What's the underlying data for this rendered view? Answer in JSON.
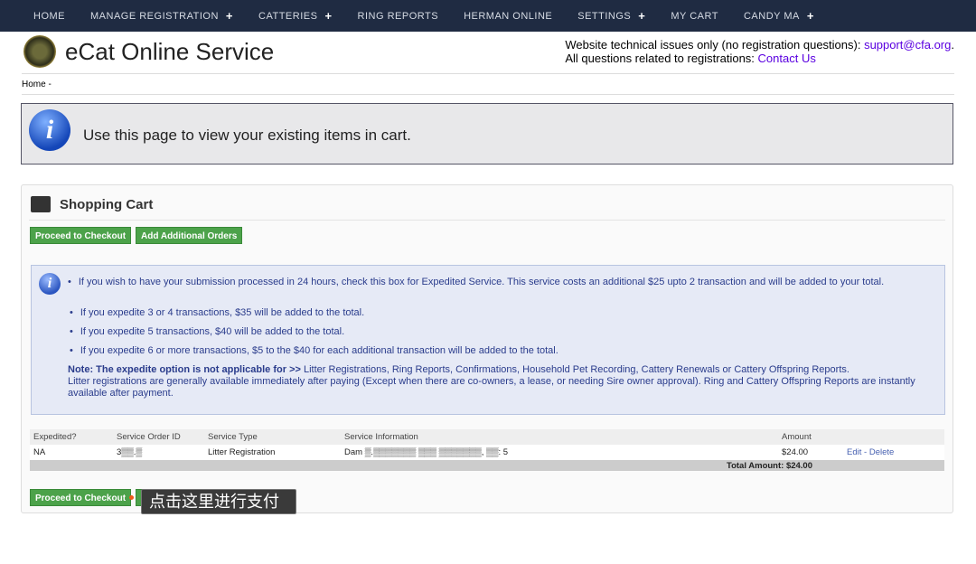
{
  "nav": {
    "items": [
      {
        "label": "HOME",
        "plus": false
      },
      {
        "label": "MANAGE REGISTRATION",
        "plus": true
      },
      {
        "label": "CATTERIES",
        "plus": true
      },
      {
        "label": "RING REPORTS",
        "plus": false
      },
      {
        "label": "HERMAN ONLINE",
        "plus": false
      },
      {
        "label": "SETTINGS",
        "plus": true
      },
      {
        "label": "MY CART",
        "plus": false
      },
      {
        "label": "CANDY MA",
        "plus": true
      }
    ],
    "plus_symbol": "+"
  },
  "header": {
    "title": "eCat Online Service",
    "tech_text": "Website technical issues only (no registration questions): ",
    "tech_email": "support@cfa.org",
    "tech_suffix": ".",
    "reg_text": "All questions related to registrations: ",
    "reg_link": "Contact Us"
  },
  "breadcrumb": "Home -",
  "info": {
    "icon": "i",
    "text": "Use this page to view your existing items in cart."
  },
  "cart": {
    "title": "Shopping Cart",
    "proceed": "Proceed to Checkout",
    "add": "Add Additional Orders"
  },
  "note": {
    "icon": "i",
    "bullets": [
      "If you wish to have your submission processed in 24 hours, check this box for Expedited Service. This service costs an additional $25 upto 2 transaction and will be added to your total.",
      "If you expedite 3 or 4 transactions, $35 will be added to the total.",
      "If you expedite 5 transactions, $40 will be added to the total.",
      "If you expedite 6 or more transactions, $5 to the $40 for each additional transaction will be added to the total."
    ],
    "note_label": "Note: The expedite option is not applicable for >>",
    "links": [
      "Litter Registrations",
      "Ring Reports",
      "Confirmations",
      "Household Pet Recording",
      "Cattery Renewals",
      "Cattery Offspring Reports"
    ],
    "or": " or ",
    "availability": "Litter registrations are generally available immediately after paying (Except when there are co-owners, a lease, or needing Sire owner approval). Ring and Cattery Offspring Reports are instantly available after payment."
  },
  "table": {
    "headers": [
      "Expedited?",
      "Service Order ID",
      "Service Type",
      "Service Information",
      "Amount"
    ],
    "rows": [
      {
        "expedited": "NA",
        "order_id": "3▒▒.▒",
        "type": "Litter Registration",
        "info": "Dam ▒.▒▒▒▒▒▒▒ ▒▒▒ ▒▒▒▒▒▒▒, ▒▒: 5",
        "amount": "$24.00",
        "edit": "Edit",
        "sep": " - ",
        "delete": "Delete"
      }
    ],
    "total": "Total Amount: $24.00"
  },
  "tooltip": "点击这里进行支付"
}
